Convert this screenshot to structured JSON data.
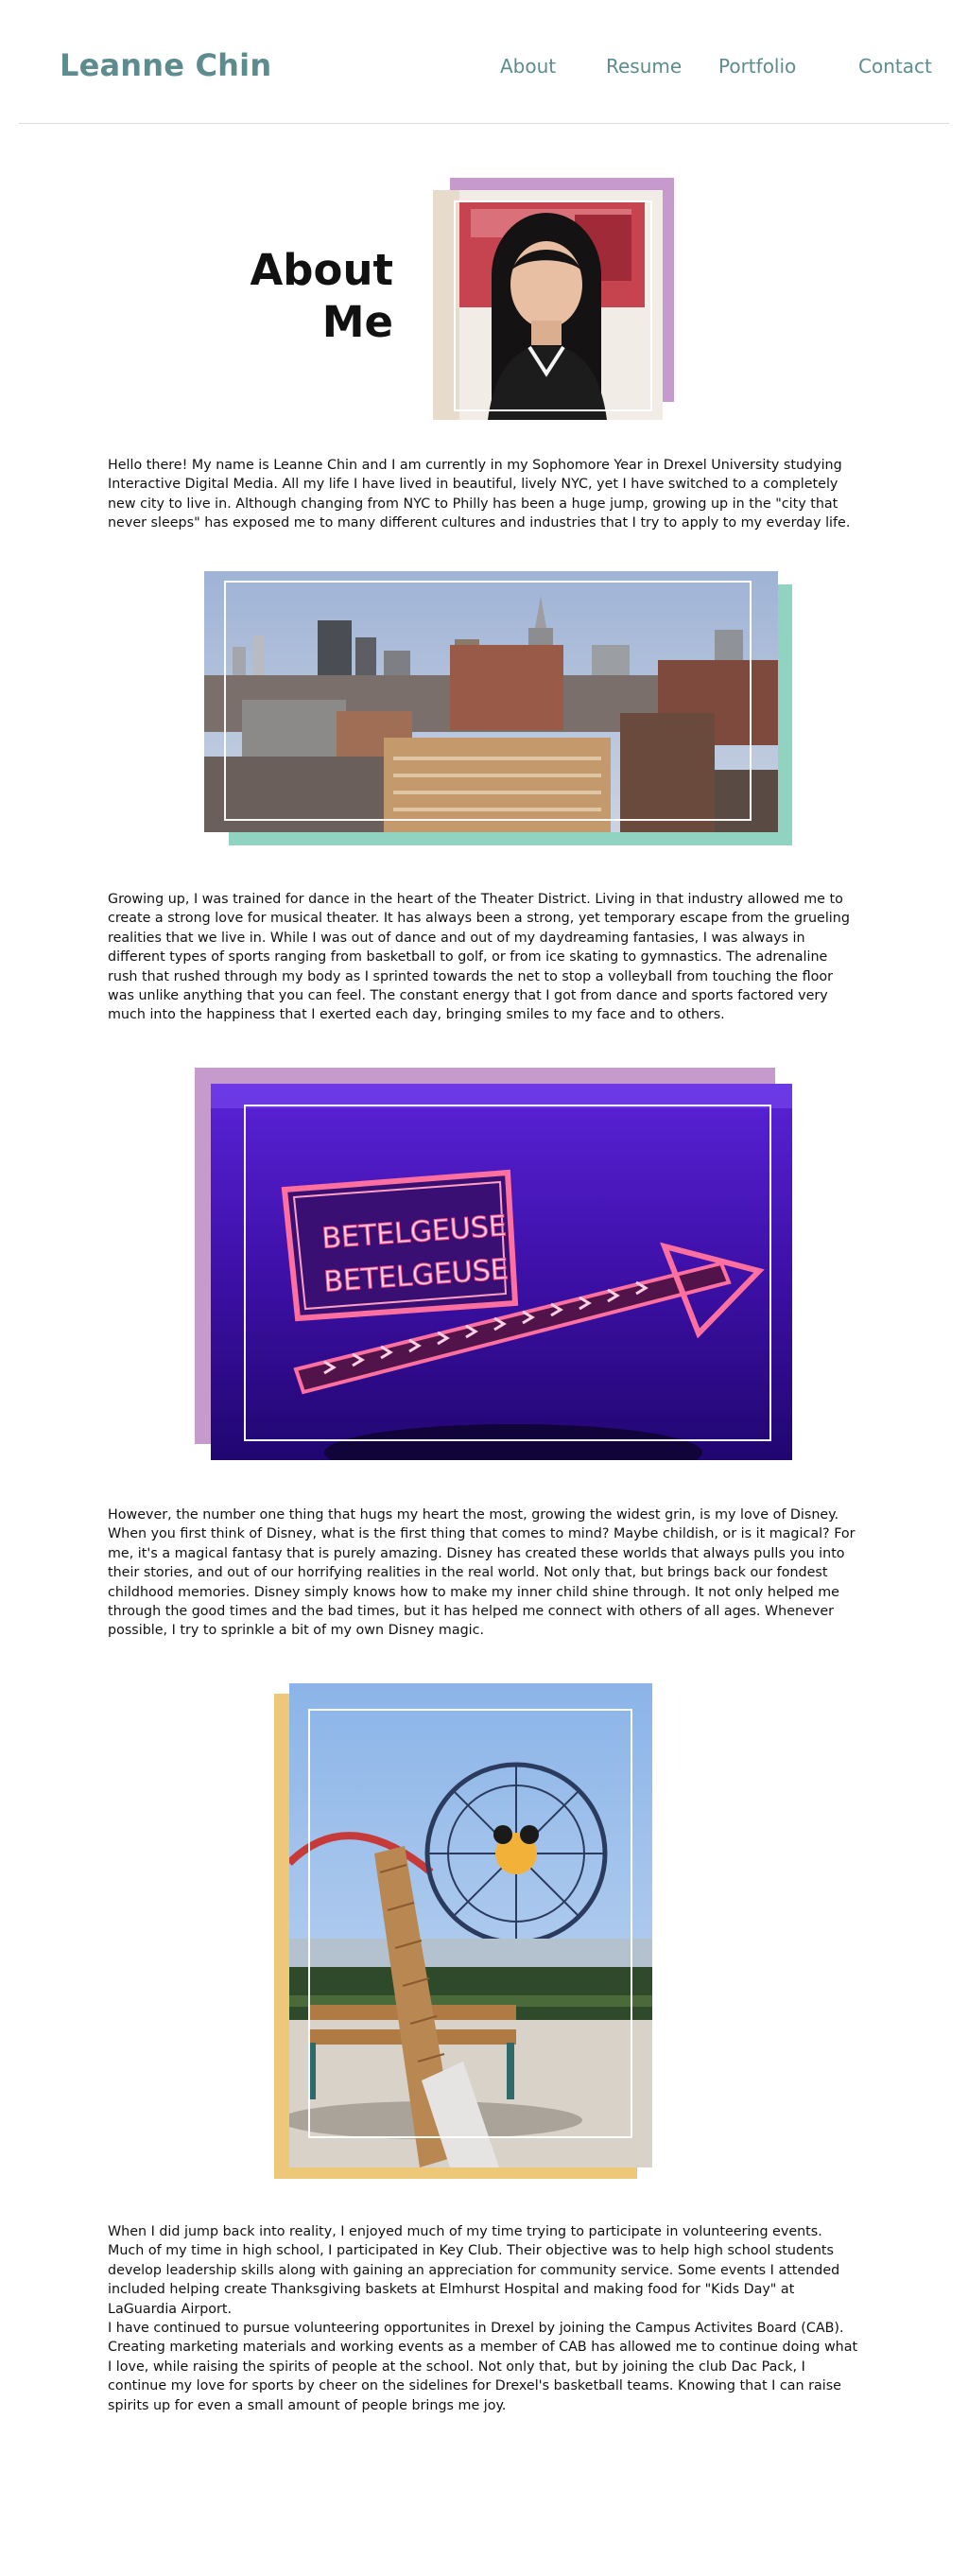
{
  "header": {
    "logo": "Leanne Chin",
    "nav": [
      "About",
      "Resume",
      "Portfolio",
      "Contact"
    ]
  },
  "about": {
    "title_line1": "About",
    "title_line2": "Me"
  },
  "paragraphs": [
    "Hello there! My name is Leanne Chin and I am currently in my Sophomore Year in Drexel University studying Interactive Digital Media. All my life I have lived in beautiful, lively NYC, yet I have switched to a completely new city to live in. Although changing from NYC to Philly has been a huge jump, growing up in the \"city that never sleeps\" has exposed me to many different cultures and industries that I try to apply to my everday life.",
    "Growing up, I was trained for dance in the heart of the Theater District. Living in that industry allowed me to create a strong love for musical theater. It has always been a strong, yet temporary escape from the grueling realities that we live in. While I was out of dance and out of my daydreaming fantasies, I was always in different types of sports ranging from basketball to golf, or from ice skating to gymnastics. The adrenaline rush that rushed through my body as I sprinted towards the net to stop a volleyball from touching the floor was unlike anything that you can feel. The constant energy that I got from dance and sports factored very much into the happiness that I exerted each day, bringing smiles to my face and to others.",
    "However, the number one thing that hugs my heart the most, growing the widest grin, is my love of Disney. When you first think of Disney, what is the first thing that comes to mind? Maybe childish, or is it magical? For me, it's a magical fantasy that is purely amazing. Disney has created these worlds that always pulls you into their stories, and out of our horrifying realities in the real world. Not only that, but brings back our fondest childhood memories. Disney simply knows how to make my inner child shine through. It not only helped me through the good times and the bad times, but it has helped me connect with others of all ages. Whenever possible, I try to sprinkle a bit of my own Disney magic.",
    "When I did jump back into reality, I enjoyed much of my time trying to participate in volunteering events. Much of my time in high school, I participated in Key Club. Their objective was to help high school students develop leadership skills along with gaining an appreciation for community service. Some events I attended included helping create Thanksgiving baskets at Elmhurst Hospital and making food for \"Kids Day\" at LaGuardia Airport.",
    "I have continued to pursue volunteering opportunites in Drexel by joining the Campus Activites Board (CAB). Creating marketing materials and working events as a member of CAB has allowed me to continue doing what I love, while raising the spirits of people at the school. Not only that, but by joining the club Dac Pack, I continue my love for sports by cheer on the sidelines for Drexel's basketball teams. Knowing that I can raise spirits up for even a small amount of people brings me joy."
  ],
  "sign": {
    "line1": "BETELGEUSE",
    "line2": "BETELGEUSE"
  },
  "colors": {
    "brand": "#5c8c8e",
    "accent_purple": "#c79ace",
    "accent_teal": "#8fd3c0",
    "accent_yellow": "#edc878"
  }
}
